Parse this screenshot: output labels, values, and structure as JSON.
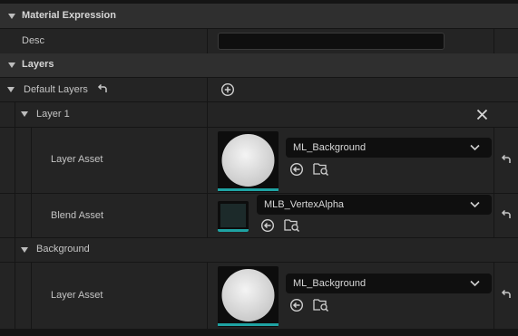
{
  "material_expression": {
    "title": "Material Expression",
    "desc_label": "Desc",
    "desc_value": ""
  },
  "layers": {
    "title": "Layers",
    "default_layers_label": "Default Layers",
    "layer1": {
      "title": "Layer 1",
      "layer_asset_label": "Layer Asset",
      "layer_asset_value": "ML_Background",
      "blend_asset_label": "Blend Asset",
      "blend_asset_value": "MLB_VertexAlpha"
    },
    "background": {
      "title": "Background",
      "layer_asset_label": "Layer Asset",
      "layer_asset_value": "ML_Background"
    }
  },
  "icons": [
    "caret-down-icon",
    "reset-arrow-icon",
    "add-circle-icon",
    "close-icon",
    "use-selected-icon",
    "browse-icon",
    "chevron-down-icon"
  ],
  "colors": {
    "accent": "#1fa3a3",
    "panel": "#242424",
    "category": "#2f2f2f",
    "field": "#0f0f0f"
  }
}
